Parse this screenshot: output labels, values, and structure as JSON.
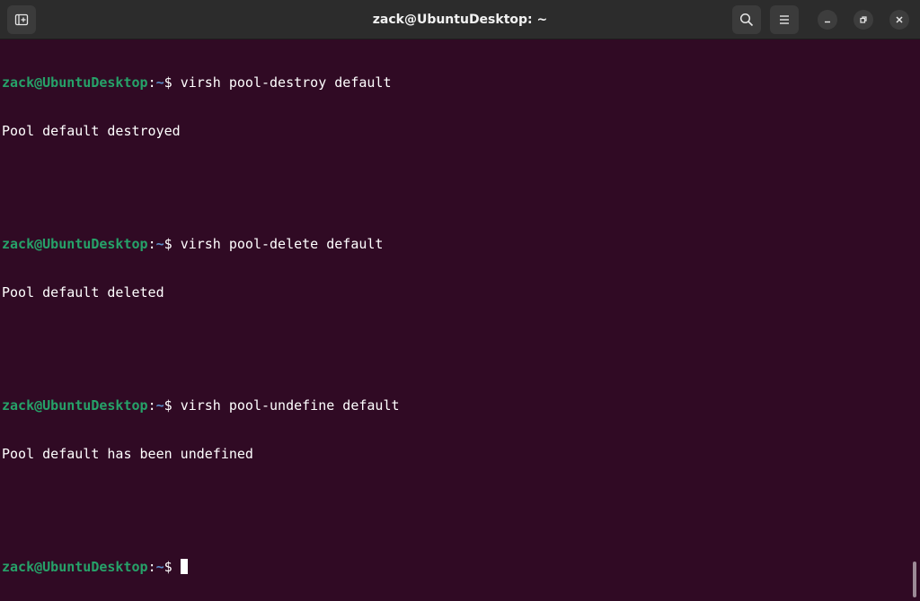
{
  "window": {
    "title": "zack@UbuntuDesktop: ~"
  },
  "titlebar": {
    "new_tab_icon": "new-tab-icon",
    "search_icon": "search-icon",
    "menu_icon": "hamburger-menu-icon",
    "minimize_icon": "minimize-icon",
    "restore_icon": "restore-icon",
    "close_icon": "close-icon"
  },
  "terminal": {
    "prompt": {
      "user_host": "zack@UbuntuDesktop",
      "separator": ":",
      "path": "~",
      "symbol": "$ "
    },
    "entries": [
      {
        "command": "virsh pool-destroy default",
        "output": "Pool default destroyed"
      },
      {
        "command": "virsh pool-delete default",
        "output": "Pool default deleted"
      },
      {
        "command": "virsh pool-undefine default",
        "output": "Pool default has been undefined"
      }
    ],
    "current_input": ""
  },
  "colors": {
    "background": "#300a24",
    "titlebar": "#2c2c2c",
    "prompt_user": "#26a269",
    "prompt_path": "#5b8ec9",
    "text": "#ffffff"
  }
}
